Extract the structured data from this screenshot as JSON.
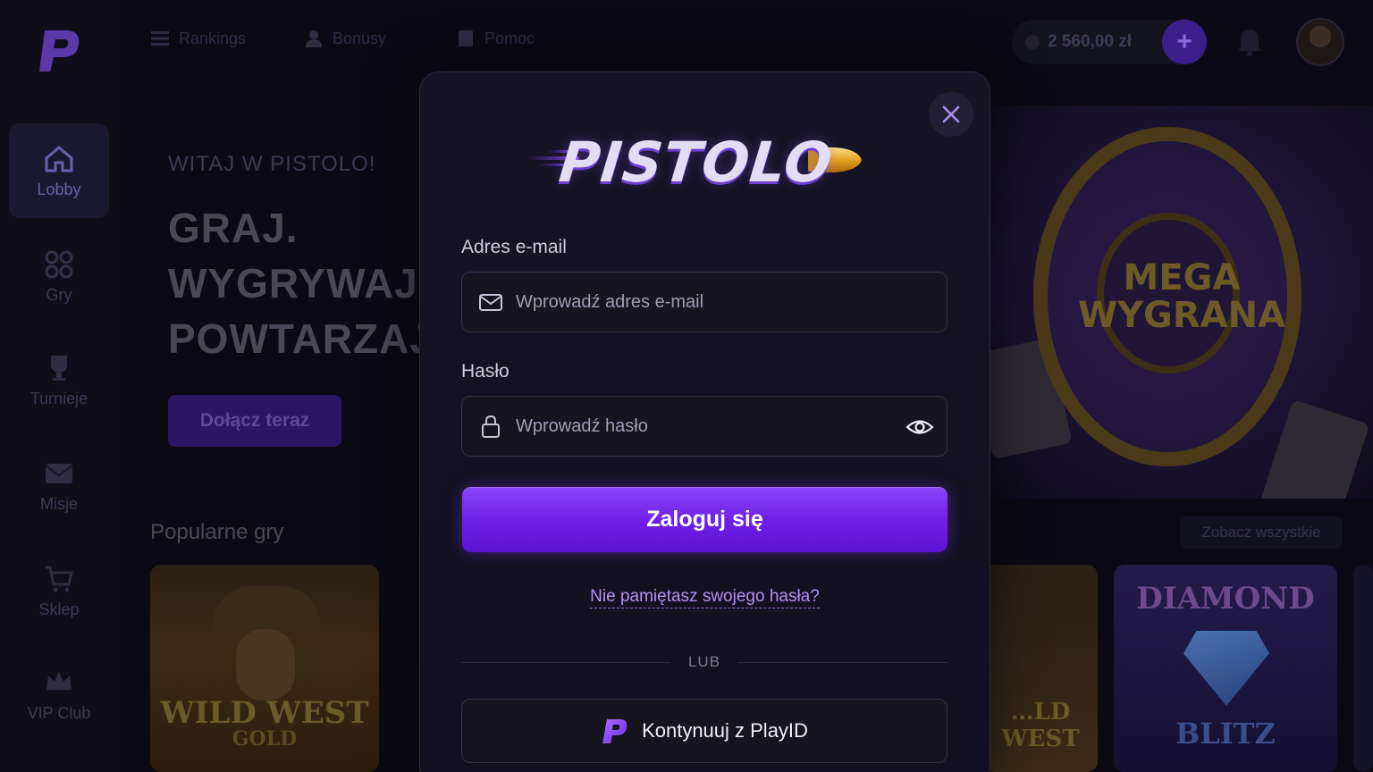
{
  "nav": {
    "items": [
      {
        "label": "Lobby",
        "icon": "home-icon"
      },
      {
        "label": "Gry",
        "icon": "games-icon"
      },
      {
        "label": "Turnieje",
        "icon": "trophy-icon"
      },
      {
        "label": "Misje",
        "icon": "mail-icon"
      },
      {
        "label": "Sklep",
        "icon": "cart-icon"
      },
      {
        "label": "VIP Club",
        "icon": "crown-icon"
      }
    ]
  },
  "topbar": {
    "links": [
      "Rankings",
      "Bonusy",
      "Pomoc"
    ],
    "balance": "2 560,00 zł",
    "deposit_icon": "+"
  },
  "hero": {
    "kicker": "WITAJ W PISTOLO!",
    "line1": "GRAJ.",
    "line2": "WYGRYWAJ.",
    "line3": "POWTARZAJ.",
    "cta": "Dołącz teraz"
  },
  "popular": {
    "title": "Popularne gry",
    "see_all": "Zobacz wszystkie",
    "games": [
      {
        "title_top": "WILD WEST",
        "title_bottom": "GOLD"
      },
      {
        "title_top": "DIAMOND",
        "title_bottom": "BLITZ"
      }
    ],
    "mid_card_label": "…LD WEST"
  },
  "banner": {
    "line1": "MEGA",
    "line2": "WYGRANA"
  },
  "modal": {
    "brand": "PISTOLO",
    "email_label": "Adres e-mail",
    "email_placeholder": "Wprowadź adres e-mail",
    "email_value": "",
    "password_label": "Hasło",
    "password_placeholder": "Wprowadź hasło",
    "password_value": "",
    "login_button": "Zaloguj się",
    "forgot_link": "Nie pamiętasz swojego hasła?",
    "or_text": "LUB",
    "playid_button": "Kontynuuj z PlayID"
  },
  "colors": {
    "accent": "#6d1ee6",
    "link": "#b78ef7",
    "background": "#0b0a14"
  }
}
